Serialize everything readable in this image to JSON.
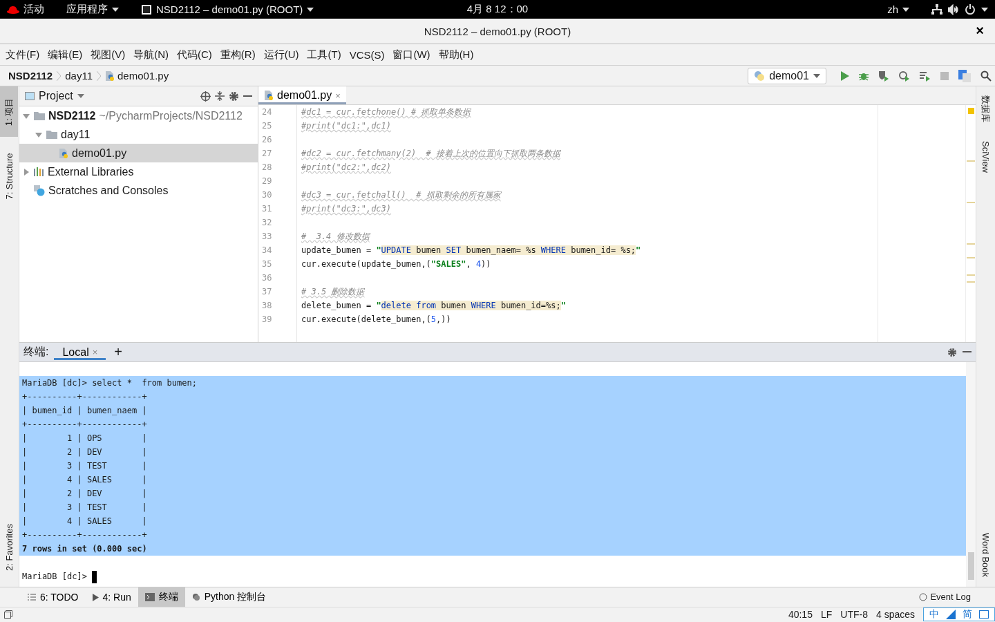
{
  "top_bar": {
    "activities": "活动",
    "applications": "应用程序",
    "app_window": "NSD2112 – demo01.py (ROOT)",
    "clock": "4月 8  12：00",
    "language": "zh"
  },
  "window": {
    "title": "NSD2112 – demo01.py (ROOT)",
    "close": "×"
  },
  "menu": [
    "文件(F)",
    "编辑(E)",
    "视图(V)",
    "导航(N)",
    "代码(C)",
    "重构(R)",
    "运行(U)",
    "工具(T)",
    "VCS(S)",
    "窗口(W)",
    "帮助(H)"
  ],
  "breadcrumb": [
    "NSD2112",
    "day11",
    "demo01.py"
  ],
  "run_config": "demo01",
  "left_stripe": {
    "top": [
      {
        "label": "1: 项目",
        "selected": true
      },
      {
        "label": "7: Structure",
        "selected": false
      }
    ],
    "bottom": [
      {
        "label": "2: Favorites",
        "selected": false
      }
    ]
  },
  "right_stripe": {
    "top": [
      {
        "label": "数据库"
      },
      {
        "label": "SciView"
      }
    ],
    "bottom": [
      {
        "label": "Word Book"
      }
    ]
  },
  "project": {
    "title": "Project",
    "tree": [
      {
        "label": "NSD2112",
        "path": "~/PycharmProjects/NSD2112",
        "kind": "folder",
        "expanded": true,
        "selected": false,
        "children": [
          {
            "label": "day11",
            "kind": "folder",
            "expanded": true,
            "selected": false,
            "children": [
              {
                "label": "demo01.py",
                "kind": "python",
                "selected": true
              }
            ]
          }
        ]
      },
      {
        "label": "External Libraries",
        "kind": "library",
        "expanded": false,
        "selected": false
      },
      {
        "label": "Scratches and Consoles",
        "kind": "scratch",
        "selected": false
      }
    ]
  },
  "editor": {
    "tabs": [
      {
        "label": "demo01.py",
        "selected": true,
        "close": "×"
      }
    ],
    "lines": [
      {
        "number": "24",
        "tokens": [
          {
            "kind": "c",
            "text": "#dc1 = cur.fetchone() # 抓取单条数据"
          }
        ]
      },
      {
        "number": "25",
        "tokens": [
          {
            "kind": "c",
            "text": "#print(\"dc1:\",dc1)"
          }
        ]
      },
      {
        "number": "26"
      },
      {
        "number": "27",
        "tokens": [
          {
            "kind": "c",
            "text": "#dc2 = cur.fetchmany(2)  # 接着上次的位置向下抓取两条数据"
          }
        ]
      },
      {
        "number": "28",
        "tokens": [
          {
            "kind": "c",
            "text": "#print(\"dc2:\",dc2)"
          }
        ]
      },
      {
        "number": "29"
      },
      {
        "number": "30",
        "tokens": [
          {
            "kind": "c",
            "text": "#dc3 = cur.fetchall()  # 抓取剩余的所有属家"
          }
        ]
      },
      {
        "number": "31",
        "tokens": [
          {
            "kind": "c",
            "text": "#print(\"dc3:\",dc3)"
          }
        ]
      },
      {
        "number": "32"
      },
      {
        "number": "33",
        "tokens": [
          {
            "kind": "c",
            "text": "#  3.4 修改数据"
          }
        ]
      },
      {
        "number": "34",
        "tokens": [
          {
            "kind": "p",
            "text": "update_bumen = "
          },
          {
            "kind": "s",
            "text": "\""
          },
          {
            "kind": "k",
            "text": "UPDATE"
          },
          {
            "kind": "t",
            "text": " bumen "
          },
          {
            "kind": "k",
            "text": "SET"
          },
          {
            "kind": "t",
            "text": " bumen_naem= %s "
          },
          {
            "kind": "k",
            "text": "WHERE"
          },
          {
            "kind": "t",
            "text": " bumen_id= %s;"
          },
          {
            "kind": "s",
            "text": "\""
          }
        ]
      },
      {
        "number": "35",
        "tokens": [
          {
            "kind": "p",
            "text": "cur.execute(update_bumen,("
          },
          {
            "kind": "s",
            "text": "\"SALES\""
          },
          {
            "kind": "p",
            "text": ", "
          },
          {
            "kind": "n",
            "text": "4"
          },
          {
            "kind": "p",
            "text": "))"
          }
        ]
      },
      {
        "number": "36"
      },
      {
        "number": "37",
        "tokens": [
          {
            "kind": "c",
            "text": "# 3.5 删除数据"
          }
        ]
      },
      {
        "number": "38",
        "tokens": [
          {
            "kind": "p",
            "text": "delete_bumen = "
          },
          {
            "kind": "s",
            "text": "\""
          },
          {
            "kind": "k",
            "text": "delete from"
          },
          {
            "kind": "t",
            "text": " bumen "
          },
          {
            "kind": "k",
            "text": "WHERE"
          },
          {
            "kind": "t",
            "text": " bumen_id=%s;"
          },
          {
            "kind": "s",
            "text": "\""
          }
        ]
      },
      {
        "number": "39",
        "tokens": [
          {
            "kind": "p",
            "text": "cur.execute(delete_bumen,("
          },
          {
            "kind": "n",
            "text": "5"
          },
          {
            "kind": "p",
            "text": ",))"
          }
        ]
      }
    ]
  },
  "terminal": {
    "title": "终端:",
    "tabs": [
      {
        "label": "Local",
        "selected": true,
        "close": "×"
      }
    ],
    "add": "+",
    "lines": [
      {
        "text": "MariaDB [dc]> select *  from bumen;",
        "selected": true,
        "bold": false
      },
      {
        "text": "+----------+------------+",
        "selected": true,
        "bold": false
      },
      {
        "text": "| bumen_id | bumen_naem |",
        "selected": true,
        "bold": false
      },
      {
        "text": "+----------+------------+",
        "selected": true,
        "bold": false
      },
      {
        "text": "|        1 | OPS        |",
        "selected": true,
        "bold": false
      },
      {
        "text": "|        2 | DEV        |",
        "selected": true,
        "bold": false
      },
      {
        "text": "|        3 | TEST       |",
        "selected": true,
        "bold": false
      },
      {
        "text": "|        4 | SALES      |",
        "selected": true,
        "bold": false
      },
      {
        "text": "|        2 | DEV        |",
        "selected": true,
        "bold": false
      },
      {
        "text": "|        3 | TEST       |",
        "selected": true,
        "bold": false
      },
      {
        "text": "|        4 | SALES      |",
        "selected": true,
        "bold": false
      },
      {
        "text": "+----------+------------+",
        "selected": true,
        "bold": false
      },
      {
        "text": "7 rows in set (0.000 sec)",
        "selected": true,
        "bold": true
      }
    ],
    "prompt": "MariaDB [dc]>"
  },
  "bottom_tabs": [
    {
      "label": "6: TODO",
      "kind": "todo",
      "selected": false
    },
    {
      "label": "4: Run",
      "kind": "run",
      "selected": false
    },
    {
      "label": "终端",
      "kind": "terminal",
      "selected": true
    },
    {
      "label": "Python 控制台",
      "kind": "python",
      "selected": false
    }
  ],
  "event_log": "Event Log",
  "status_bar": {
    "position": "40:15",
    "line_ending": "LF",
    "encoding": "UTF-8",
    "indent": "4 spaces"
  },
  "ime_bar": {
    "mode": "中",
    "script": "简"
  }
}
